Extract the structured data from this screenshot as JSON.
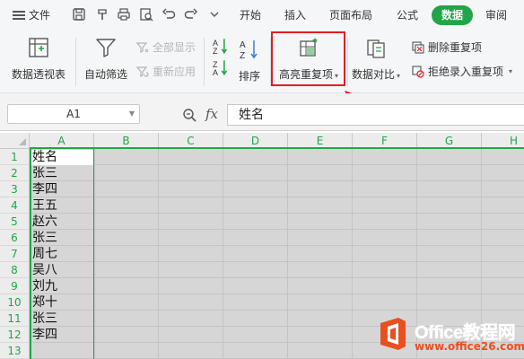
{
  "menu": {
    "file_label": "文件",
    "tabs": [
      "开始",
      "插入",
      "页面布局",
      "公式",
      "数据",
      "审阅"
    ],
    "active_tab": "数据"
  },
  "ribbon": {
    "pivot_label": "数据透视表",
    "autofilter_label": "自动筛选",
    "show_all_label": "全部显示",
    "reapply_label": "重新应用",
    "sort_label": "排序",
    "highlight_dup_label": "高亮重复项",
    "data_compare_label": "数据对比",
    "remove_dup_label": "删除重复项",
    "reject_dup_label": "拒绝录入重复项"
  },
  "formula_bar": {
    "name_box": "A1",
    "fx_label": "fx",
    "formula_value": "姓名"
  },
  "grid": {
    "columns": [
      "A",
      "B",
      "C",
      "D",
      "E",
      "F",
      "G",
      "H"
    ],
    "rows": [
      "1",
      "2",
      "3",
      "4",
      "5",
      "6",
      "7",
      "8",
      "9",
      "10",
      "11",
      "12",
      "13"
    ],
    "colA_values": [
      "姓名",
      "张三",
      "李四",
      "王五",
      "赵六",
      "张三",
      "周七",
      "吴八",
      "刘九",
      "郑十",
      "张三",
      "李四"
    ]
  },
  "watermark": {
    "brand": "Office教程网",
    "url": "www.office26.com"
  },
  "colors": {
    "accent_green": "#22a548",
    "highlight_red": "#e51c23"
  }
}
